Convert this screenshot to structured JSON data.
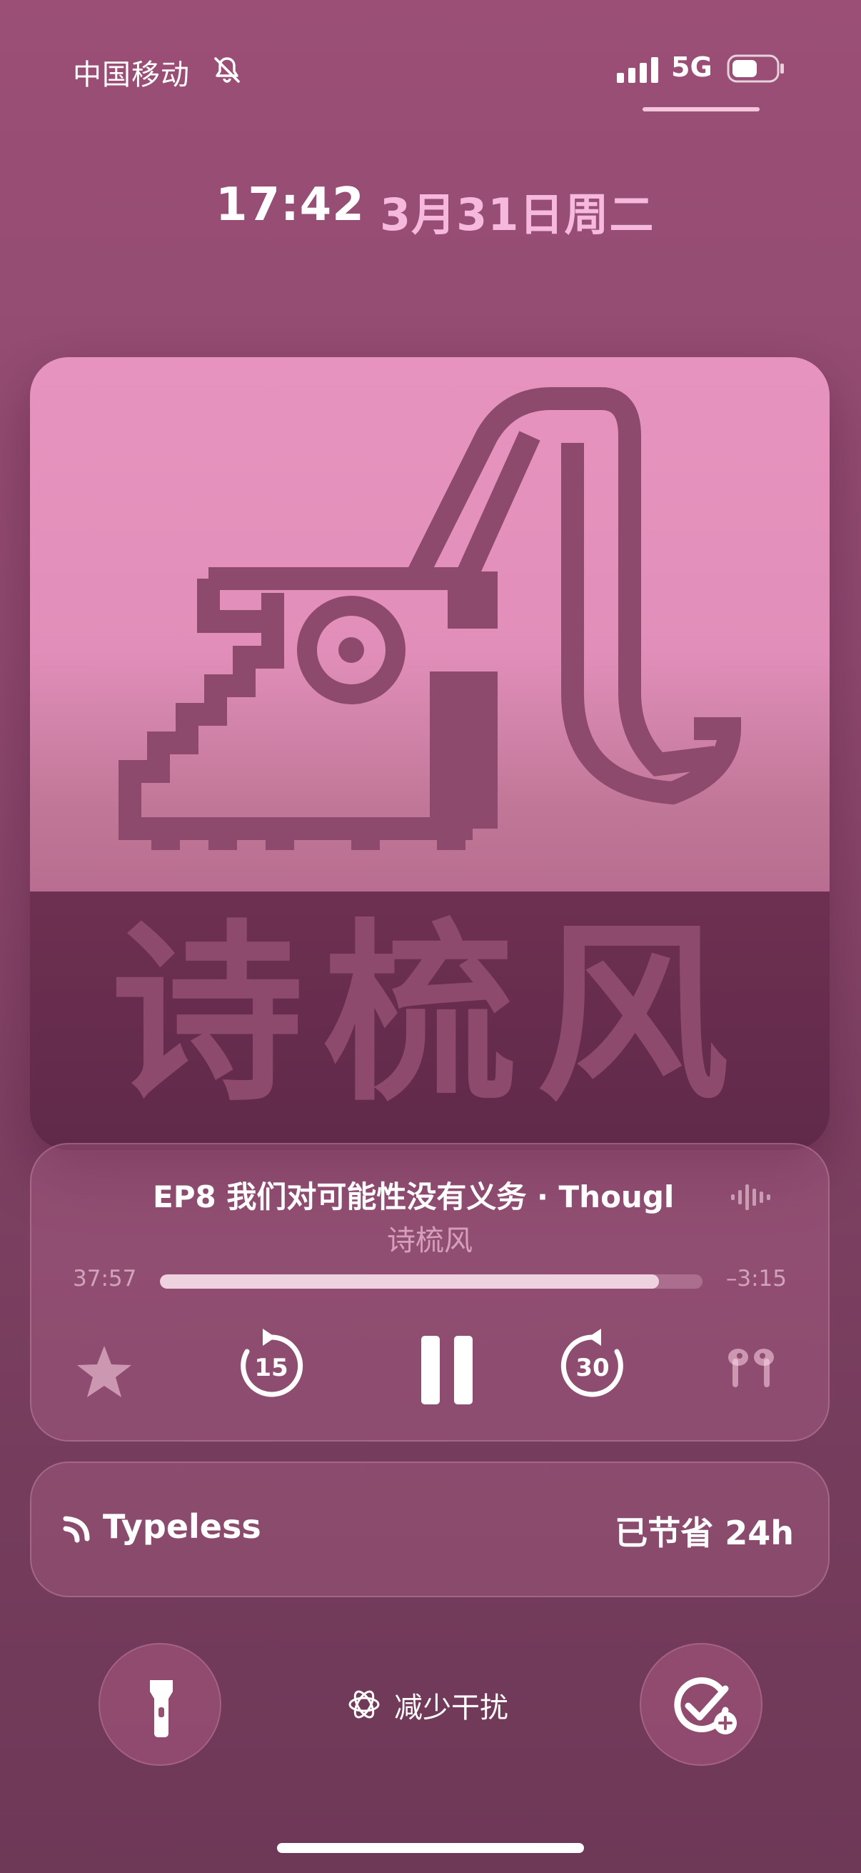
{
  "status_bar": {
    "carrier": "中国移动",
    "network": "5G"
  },
  "lock_screen": {
    "time": "17:42",
    "date": "3月31日周二"
  },
  "artwork": {
    "title": "诗梳风"
  },
  "now_playing": {
    "title": "EP8 我们对可能性没有义务 · Thougl",
    "artist": "诗梳风",
    "elapsed": "37:57",
    "remaining": "–3:15",
    "progress": 0.92,
    "rewind_seconds": "15",
    "forward_seconds": "30"
  },
  "widget": {
    "app_name": "Typeless",
    "saved_label": "已节省 24h"
  },
  "focus": {
    "label": "减少干扰"
  },
  "colors": {
    "accent_pink": "#f6b9dd",
    "art_pink": "#e793bf",
    "art_dark": "#6e3051",
    "art_mark": "#8d4a6d"
  }
}
